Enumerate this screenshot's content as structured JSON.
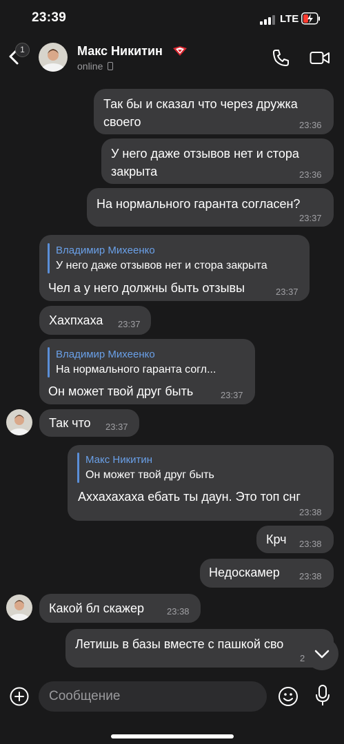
{
  "status_bar": {
    "time": "23:39",
    "network": "LTE"
  },
  "header": {
    "back_badge": "1",
    "contact_name": "Макс Никитин",
    "contact_status": "online"
  },
  "messages": [
    {
      "text_lines": [
        "Так бы и сказал что через дружка",
        "своего"
      ],
      "time": "23:36"
    },
    {
      "text_lines": [
        "У него даже отзывов нет и стора",
        "закрыта"
      ],
      "time": "23:36"
    },
    {
      "text": "На нормального гаранта согласен?",
      "time": "23:37"
    },
    {
      "reply_name": "Владимир Михеенко",
      "reply_text": "У него даже отзывов нет и стора закрыта",
      "text": "Чел а у него должны быть отзывы",
      "time": "23:37"
    },
    {
      "text": "Хахпхаха",
      "time": "23:37"
    },
    {
      "reply_name": "Владимир Михеенко",
      "reply_text": "На нормального гаранта согл...",
      "text": "Он может твой друг быть",
      "time": "23:37"
    },
    {
      "text": "Так что",
      "time": "23:37"
    },
    {
      "reply_name": "Макс Никитин",
      "reply_text": "Он может твой друг быть",
      "text": "Аххахахаха ебать ты даун. Это топ снг",
      "time": "23:38"
    },
    {
      "text": "Крч",
      "time": "23:38"
    },
    {
      "text": "Недоскамер",
      "time": "23:38"
    },
    {
      "text": "Какой бл скажер",
      "time": "23:38"
    },
    {
      "text": "Летишь в базы вместе с пашкой сво",
      "time": "2"
    }
  ],
  "composer": {
    "placeholder": "Сообщение"
  },
  "icons": [
    "back-arrow-icon",
    "phone-icon",
    "video-icon",
    "plus-icon",
    "emoji-icon",
    "microphone-icon",
    "chevron-down-icon",
    "spartak-icon",
    "battery-icon",
    "signal-icon"
  ],
  "colors": {
    "background": "#19191a",
    "bubble": "#3a3a3c",
    "reply_accent": "#6aa0e8"
  }
}
